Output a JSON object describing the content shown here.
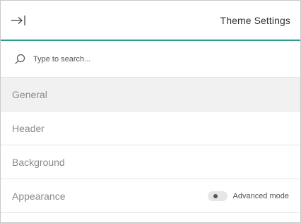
{
  "header": {
    "title": "Theme Settings",
    "collapse_icon": "arrow-to-right-icon"
  },
  "search": {
    "placeholder": "Type to search...",
    "icon": "search-icon"
  },
  "menu": {
    "items": [
      {
        "label": "General",
        "active": true
      },
      {
        "label": "Header"
      },
      {
        "label": "Background"
      },
      {
        "label": "Appearance"
      }
    ]
  },
  "advanced_mode": {
    "label": "Advanced mode",
    "enabled": false
  },
  "colors": {
    "accent": "#2a9d92",
    "active_row": "#f1f1f1"
  }
}
